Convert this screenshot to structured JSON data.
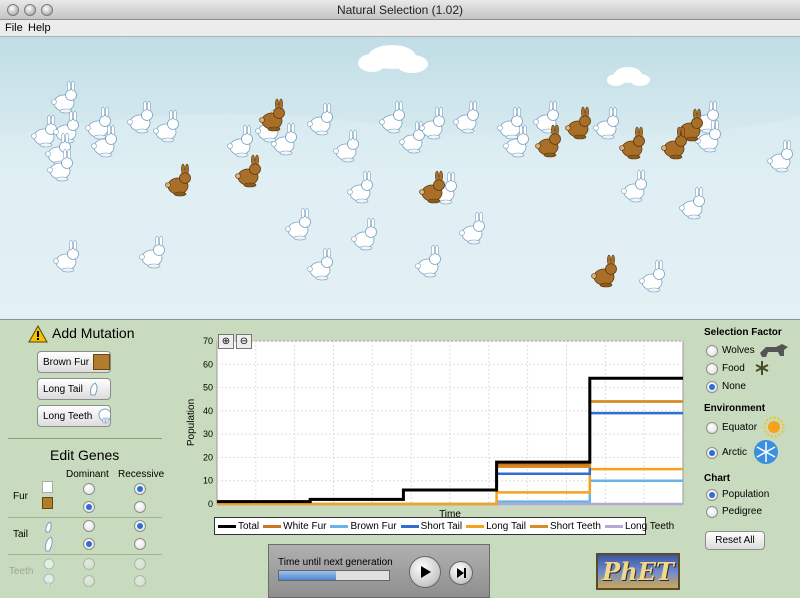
{
  "window": {
    "title": "Natural Selection (1.02)"
  },
  "menu": {
    "items": [
      "File",
      "Help"
    ]
  },
  "mutation": {
    "title": "Add Mutation",
    "buttons": [
      {
        "label": "Brown Fur",
        "icon": "brown-fur-swatch"
      },
      {
        "label": "Long Tail",
        "icon": "long-tail-icon"
      },
      {
        "label": "Long Teeth",
        "icon": "long-teeth-icon"
      }
    ]
  },
  "genes": {
    "title": "Edit Genes",
    "col_dominant": "Dominant",
    "col_recessive": "Recessive",
    "rows": [
      {
        "label": "Fur",
        "enabled": true,
        "dominant": false,
        "recessive": true
      },
      {
        "label": "Tail",
        "enabled": true,
        "dominant": false,
        "recessive": true
      },
      {
        "label": "Teeth",
        "enabled": false,
        "dominant": false,
        "recessive": false
      }
    ]
  },
  "selection": {
    "title": "Selection Factor",
    "options": [
      {
        "label": "Wolves",
        "selected": false,
        "icon": "wolf-icon"
      },
      {
        "label": "Food",
        "selected": false,
        "icon": "food-icon"
      },
      {
        "label": "None",
        "selected": true
      }
    ]
  },
  "environment": {
    "title": "Environment",
    "options": [
      {
        "label": "Equator",
        "selected": false,
        "icon": "sun-icon"
      },
      {
        "label": "Arctic",
        "selected": true,
        "icon": "snowflake-icon"
      }
    ]
  },
  "chart_choice": {
    "title": "Chart",
    "options": [
      {
        "label": "Population",
        "selected": true
      },
      {
        "label": "Pedigree",
        "selected": false
      }
    ]
  },
  "reset_label": "Reset All",
  "time_panel": {
    "label": "Time until next generation",
    "progress": 0.52
  },
  "logo_text": "PhET",
  "colors": {
    "total": "#000000",
    "white_fur": "#c8781e",
    "brown_fur": "#66b4e8",
    "short_tail": "#2f6fd3",
    "long_tail": "#f5a21f",
    "short_teeth": "#d88c26",
    "long_teeth": "#b3a9d4"
  },
  "chart_data": {
    "type": "line",
    "xlabel": "Time",
    "ylabel": "Population",
    "ylim": [
      0,
      70
    ],
    "yticks": [
      0,
      10,
      20,
      30,
      40,
      50,
      60,
      70
    ],
    "grid": true,
    "legend_position": "bottom",
    "x": [
      0,
      1,
      2,
      3,
      4,
      5
    ],
    "series": [
      {
        "name": "Total",
        "values": [
          1,
          2,
          6,
          18,
          54,
          54
        ]
      },
      {
        "name": "White Fur",
        "values": [
          1,
          2,
          6,
          17,
          44,
          44
        ]
      },
      {
        "name": "Brown Fur",
        "values": [
          0,
          0,
          0,
          1,
          10,
          10
        ]
      },
      {
        "name": "Short Tail",
        "values": [
          1,
          2,
          6,
          13,
          39,
          39
        ]
      },
      {
        "name": "Long Tail",
        "values": [
          0,
          0,
          0,
          5,
          15,
          15
        ]
      },
      {
        "name": "Short Teeth",
        "values": [
          1,
          2,
          6,
          16,
          44,
          44
        ]
      },
      {
        "name": "Long Teeth",
        "values": [
          0,
          0,
          0,
          0,
          0,
          0
        ]
      }
    ]
  }
}
